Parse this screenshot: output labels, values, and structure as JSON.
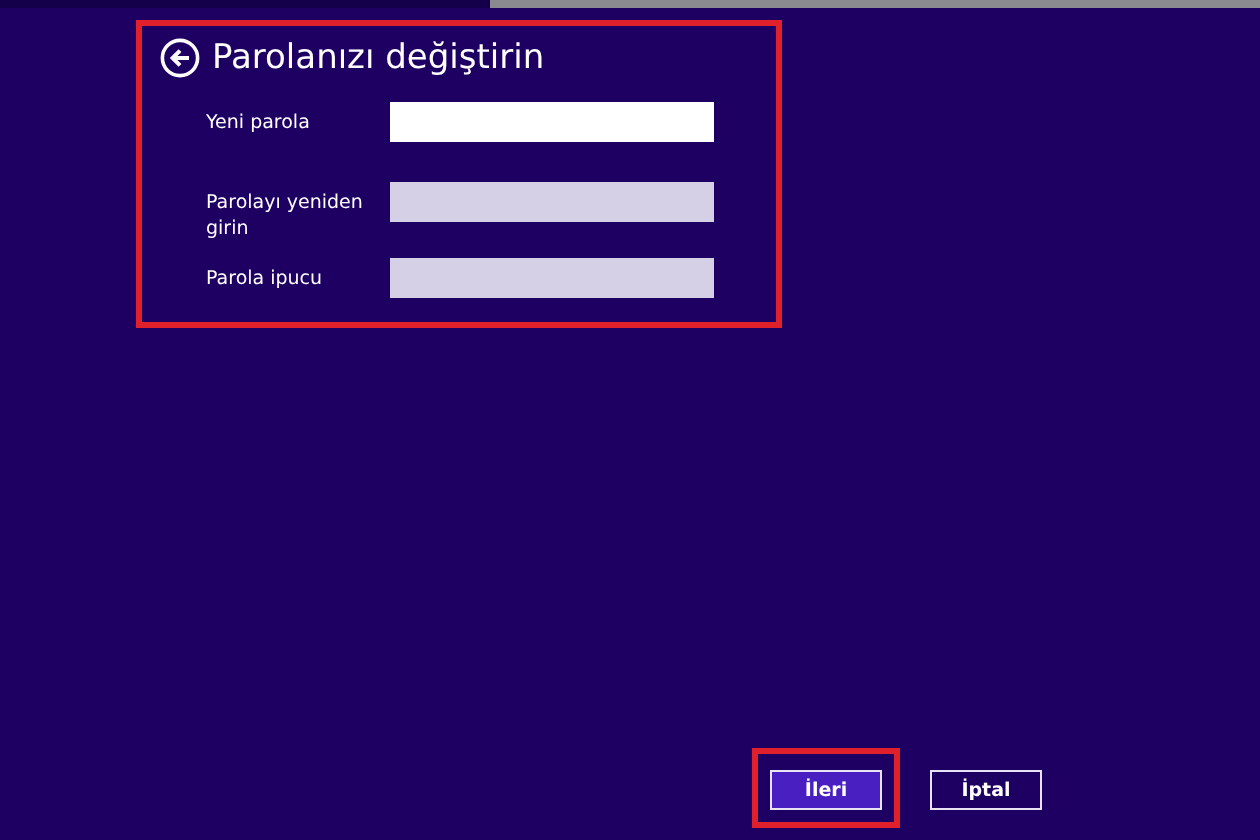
{
  "panel": {
    "title": "Parolanızı değiştirin",
    "highlighted": true
  },
  "fields": [
    {
      "label": "Yeni parola",
      "focused": true
    },
    {
      "label": "Parolayı yeniden girin",
      "focused": false
    },
    {
      "label": "Parola ipucu",
      "focused": false
    }
  ],
  "buttons": [
    {
      "label": "İleri",
      "kind": "primary",
      "highlighted": true
    },
    {
      "label": "İptal",
      "kind": "secondary",
      "highlighted": false
    }
  ]
}
